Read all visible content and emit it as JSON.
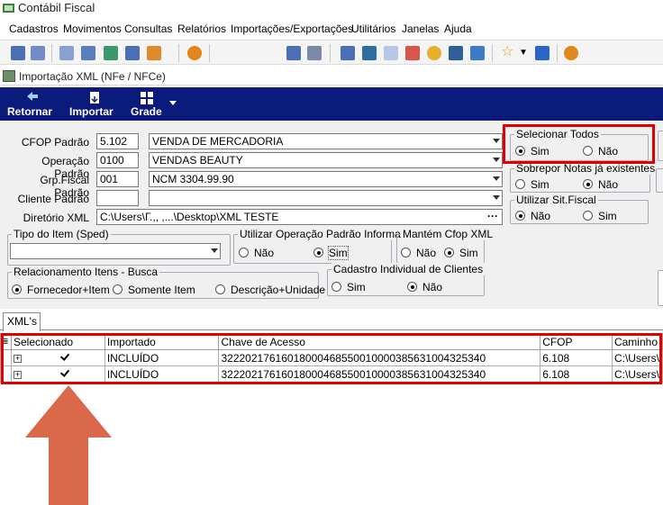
{
  "app": {
    "title": "Contábil Fiscal"
  },
  "menu": [
    "Cadastros",
    "Movimentos",
    "Consultas",
    "Relatórios",
    "Importações/Exportações",
    "Utilitários",
    "Janelas",
    "Ajuda"
  ],
  "window": {
    "title": "Importação XML (NFe / NFCe)"
  },
  "actions": {
    "back": "Retornar",
    "import": "Importar",
    "grid": "Grade"
  },
  "form": {
    "cfop_label": "CFOP Padrão",
    "cfop_code": "5.102",
    "cfop_desc": "VENDA DE MERCADORIA",
    "operacao_label": "Operação Padrão",
    "operacao_code": "0100",
    "operacao_desc": "VENDAS BEAUTY",
    "grpfiscal_label": "Grp.Fiscal Padrão",
    "grpfiscal_code": "001",
    "grpfiscal_desc": "NCM 3304.99.90",
    "cliente_label": "Cliente Padrão",
    "cliente_code": "",
    "cliente_desc": "",
    "diretorio_label": "Diretório XML",
    "diretorio_value": "C:\\Users\\Г.,, ,...\\Desktop\\XML TESTE",
    "tipo_item_label": "Tipo do Item (Sped)",
    "tipo_item_value": ""
  },
  "groups": {
    "selecionar_todos": {
      "title": "Selecionar Todos",
      "opt1": "Sim",
      "opt2": "Não"
    },
    "sobrepor": {
      "title": "Sobrepor Notas já existentes",
      "opt1": "Sim",
      "opt2": "Não"
    },
    "sit_fiscal": {
      "title": "Utilizar Sit.Fiscal",
      "opt1": "Não",
      "opt2": "Sim"
    },
    "operacao_xml": {
      "title": "Utilizar Operação Padrão Informada",
      "opt1": "Não",
      "opt2": "Sim"
    },
    "cfop_xml": {
      "title": "Mantém Cfop XML",
      "opt1": "Não",
      "opt2": "Sim"
    },
    "relacionamento": {
      "title": "Relacionamento Itens - Busca",
      "opt1": "Fornecedor+Item",
      "opt2": "Somente Item",
      "opt3": "Descrição+Unidade"
    },
    "cadastro_clientes": {
      "title": "Cadastro Individual de Clientes",
      "opt1": "Sim",
      "opt2": "Não"
    }
  },
  "tab": {
    "label": "XML's"
  },
  "grid": {
    "headers": [
      "Selecionado",
      "Importado",
      "Chave de Acesso",
      "CFOP",
      "Caminho"
    ],
    "rows": [
      {
        "importado": "INCLUÍDO",
        "chave": "32220217616018000468550010000385631004325340",
        "cfop": "6.108",
        "caminho": "C:\\Users\\"
      },
      {
        "importado": "INCLUÍDO",
        "chave": "32220217616018000468550010000385631004325340",
        "cfop": "6.108",
        "caminho": "C:\\Users\\"
      }
    ]
  },
  "colors": {
    "actionbar": "#0b1b7c",
    "highlight": "#e00000",
    "arrow": "#d9694a"
  }
}
